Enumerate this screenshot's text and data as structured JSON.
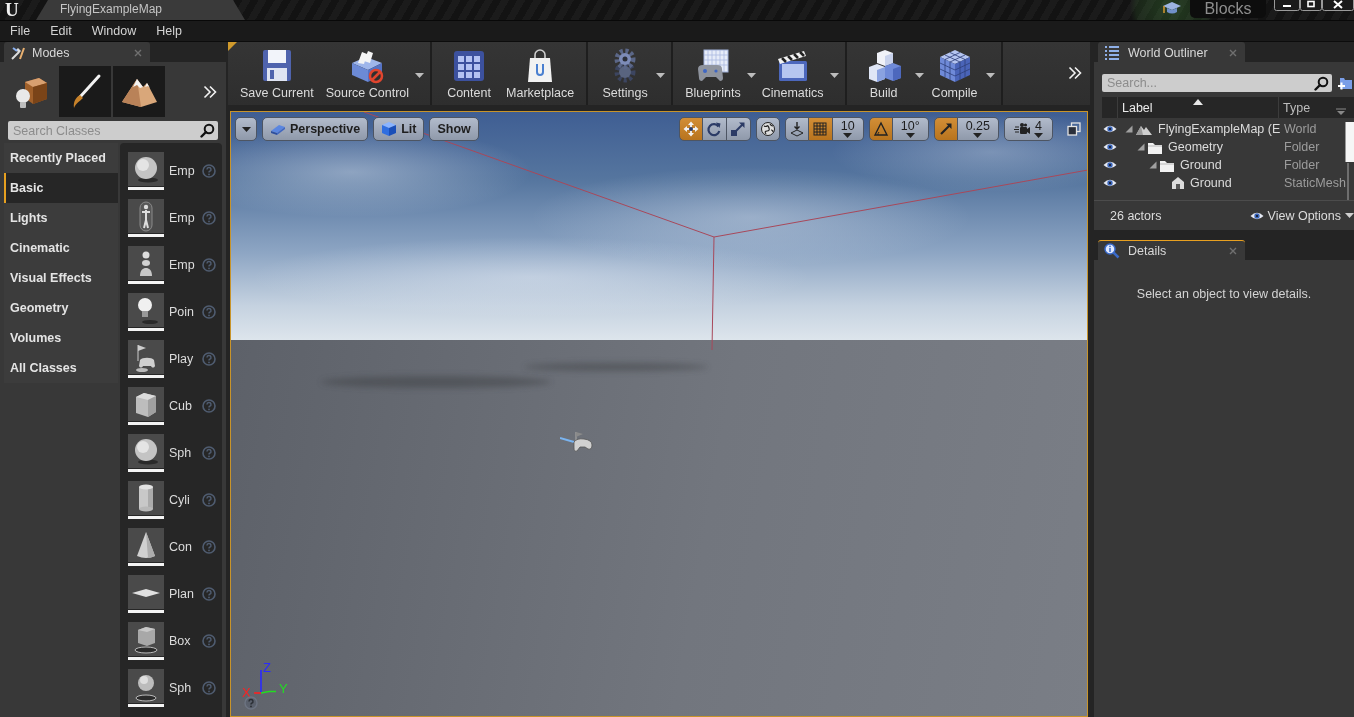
{
  "title_bar": {
    "logo": "U",
    "tab": "FlyingExampleMap",
    "project": "Blocks"
  },
  "menu": [
    "File",
    "Edit",
    "Window",
    "Help"
  ],
  "modes_panel": {
    "tab": "Modes",
    "focused": false,
    "modes": [
      {
        "kind": "place",
        "selected": true
      },
      {
        "kind": "paint",
        "selected": false
      },
      {
        "kind": "landscape",
        "selected": false
      }
    ],
    "search": {
      "placeholder": "Search Classes"
    },
    "categories": [
      {
        "label": "Recently Placed",
        "selected": false
      },
      {
        "label": "Basic",
        "selected": true
      },
      {
        "label": "Lights",
        "selected": false
      },
      {
        "label": "Cinematic",
        "selected": false
      },
      {
        "label": "Visual Effects",
        "selected": false
      },
      {
        "label": "Geometry",
        "selected": false
      },
      {
        "label": "Volumes",
        "selected": false
      },
      {
        "label": "All Classes",
        "selected": false
      }
    ],
    "items": [
      {
        "name": "Emp",
        "kind": "sphere"
      },
      {
        "name": "Emp",
        "kind": "character"
      },
      {
        "name": "Emp",
        "kind": "pawn"
      },
      {
        "name": "Poin",
        "kind": "light"
      },
      {
        "name": "Play",
        "kind": "player-start"
      },
      {
        "name": "Cub",
        "kind": "cube"
      },
      {
        "name": "Sph",
        "kind": "sphere"
      },
      {
        "name": "Cyli",
        "kind": "cylinder"
      },
      {
        "name": "Con",
        "kind": "cone"
      },
      {
        "name": "Plan",
        "kind": "plane"
      },
      {
        "name": "Box",
        "kind": "trigger-box"
      },
      {
        "name": "Sph",
        "kind": "trigger-sphere"
      }
    ]
  },
  "toolbar": {
    "groups": [
      [
        {
          "label": "Save Current",
          "kind": "save",
          "dropdown": false
        },
        {
          "label": "Source Control",
          "kind": "source-control",
          "dropdown": true
        }
      ],
      [
        {
          "label": "Content",
          "kind": "content",
          "dropdown": false
        },
        {
          "label": "Marketplace",
          "kind": "marketplace",
          "dropdown": false
        }
      ],
      [
        {
          "label": "Settings",
          "kind": "settings",
          "dropdown": true
        }
      ],
      [
        {
          "label": "Blueprints",
          "kind": "blueprints",
          "dropdown": true
        },
        {
          "label": "Cinematics",
          "kind": "cinematics",
          "dropdown": true
        }
      ],
      [
        {
          "label": "Build",
          "kind": "build",
          "dropdown": true
        },
        {
          "label": "Compile",
          "kind": "compile",
          "dropdown": true
        }
      ]
    ]
  },
  "viewport": {
    "view_buttons": [
      {
        "label": "Perspective",
        "kind": "projection"
      },
      {
        "label": "Lit",
        "kind": "view-mode"
      },
      {
        "label": "Show",
        "kind": "show-flags"
      }
    ],
    "transform_tools": [
      {
        "kind": "translate",
        "selected": true
      },
      {
        "kind": "rotate",
        "selected": false
      },
      {
        "kind": "scale",
        "selected": false
      }
    ],
    "surface_snap": {
      "on": false
    },
    "grid_snap": {
      "on": true,
      "value": "10"
    },
    "rotation_snap": {
      "on": true,
      "value": "10°"
    },
    "scale_snap": {
      "on": true,
      "value": "0.25"
    },
    "camera_speed": "4",
    "axes": {
      "x": "X",
      "y": "Y",
      "z": "Z"
    }
  },
  "world_outliner": {
    "tab": "World Outliner",
    "focused": false,
    "search": {
      "placeholder": "Search..."
    },
    "columns": [
      {
        "label": "Label",
        "sorted": true
      },
      {
        "label": "Type",
        "sorted": false
      }
    ],
    "rows": [
      {
        "label": "FlyingExampleMap (E",
        "type": "World",
        "kind": "world",
        "expanded": true,
        "children": [
          {
            "label": "Geometry",
            "type": "Folder",
            "kind": "folder",
            "expanded": true,
            "children": [
              {
                "label": "Ground",
                "type": "Folder",
                "kind": "folder",
                "expanded": true,
                "children": [
                  {
                    "label": "Ground",
                    "type": "StaticMesh",
                    "kind": "mesh"
                  }
                ]
              }
            ]
          }
        ]
      }
    ],
    "count": "26 actors",
    "view_options": "View Options"
  },
  "details": {
    "tab": "Details",
    "focused": true,
    "message": "Select an object to view details."
  }
}
